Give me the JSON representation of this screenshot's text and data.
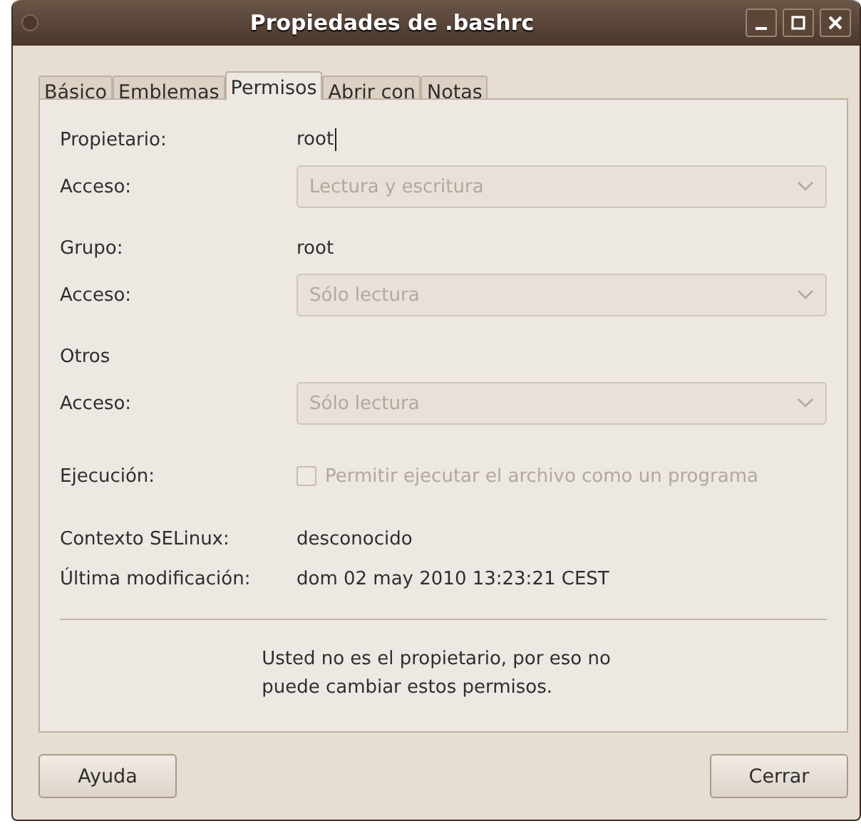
{
  "window": {
    "title": "Propiedades de .bashrc"
  },
  "tabs": [
    {
      "label": "Básico",
      "selected": false
    },
    {
      "label": "Emblemas",
      "selected": false
    },
    {
      "label": "Permisos",
      "selected": true
    },
    {
      "label": "Abrir con",
      "selected": false
    },
    {
      "label": "Notas",
      "selected": false
    }
  ],
  "rows": [
    {
      "kind": "text",
      "label": "Propietario:",
      "value": "root",
      "caret": true
    },
    {
      "kind": "combo",
      "label": "Acceso:",
      "value": "Lectura y escritura",
      "disabled": true
    },
    {
      "kind": "text",
      "label": "Grupo:",
      "value": "root",
      "caret": false
    },
    {
      "kind": "combo",
      "label": "Acceso:",
      "value": "Sólo lectura",
      "disabled": true
    },
    {
      "kind": "heading",
      "label": "Otros"
    },
    {
      "kind": "combo",
      "label": "Acceso:",
      "value": "Sólo lectura",
      "disabled": true
    },
    {
      "kind": "check",
      "label": "Ejecución:",
      "value": "Permitir ejecutar el archivo como un programa",
      "checked": false,
      "disabled": true
    }
  ],
  "info": [
    {
      "label": "Contexto SELinux:",
      "value": "desconocido"
    },
    {
      "label": "Última modificación:",
      "value": "dom 02 may 2010 13:23:21 CEST"
    }
  ],
  "notice": [
    "Usted no es el propietario, por eso no",
    "puede cambiar estos permisos."
  ],
  "buttons": [
    "Ayuda",
    "Cerrar"
  ]
}
